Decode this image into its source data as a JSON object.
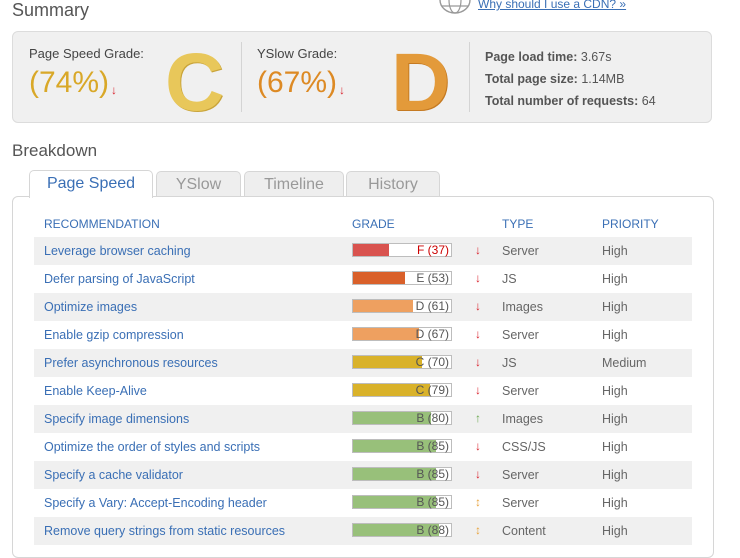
{
  "summary": {
    "title": "Summary",
    "cdn_link": "Why should I use a CDN? »",
    "pagespeed": {
      "label": "Page Speed Grade:",
      "percent": "(74%)",
      "letter": "C",
      "trend": "↓"
    },
    "yslow": {
      "label": "YSlow Grade:",
      "percent": "(67%)",
      "letter": "D",
      "trend": "↓"
    },
    "stats": [
      {
        "label": "Page load time:",
        "value": "3.67s"
      },
      {
        "label": "Total page size:",
        "value": "1.14MB"
      },
      {
        "label": "Total number of requests:",
        "value": "64"
      }
    ]
  },
  "breakdown": {
    "title": "Breakdown",
    "tabs": [
      "Page Speed",
      "YSlow",
      "Timeline",
      "History"
    ],
    "active_tab": "Page Speed",
    "headers": {
      "recommendation": "RECOMMENDATION",
      "grade": "GRADE",
      "type": "TYPE",
      "priority": "PRIORITY"
    },
    "rows": [
      {
        "rec": "Leverage browser caching",
        "grade": "F (37)",
        "score": 37,
        "color": "#d9534f",
        "trend": "↓",
        "trend_color": "#d9232e",
        "type": "Server",
        "priority": "High"
      },
      {
        "rec": "Defer parsing of JavaScript",
        "grade": "E (53)",
        "score": 53,
        "color": "#d9602a",
        "trend": "↓",
        "trend_color": "#d9232e",
        "type": "JS",
        "priority": "High"
      },
      {
        "rec": "Optimize images",
        "grade": "D (61)",
        "score": 61,
        "color": "#eea060",
        "trend": "↓",
        "trend_color": "#d9232e",
        "type": "Images",
        "priority": "High"
      },
      {
        "rec": "Enable gzip compression",
        "grade": "D (67)",
        "score": 67,
        "color": "#eea060",
        "trend": "↓",
        "trend_color": "#d9232e",
        "type": "Server",
        "priority": "High"
      },
      {
        "rec": "Prefer asynchronous resources",
        "grade": "C (70)",
        "score": 70,
        "color": "#d9b22a",
        "trend": "↓",
        "trend_color": "#d9232e",
        "type": "JS",
        "priority": "Medium"
      },
      {
        "rec": "Enable Keep-Alive",
        "grade": "C (79)",
        "score": 79,
        "color": "#d9b22a",
        "trend": "↓",
        "trend_color": "#d9232e",
        "type": "Server",
        "priority": "High"
      },
      {
        "rec": "Specify image dimensions",
        "grade": "B (80)",
        "score": 80,
        "color": "#98c07a",
        "trend": "↑",
        "trend_color": "#6aa84f",
        "type": "Images",
        "priority": "High"
      },
      {
        "rec": "Optimize the order of styles and scripts",
        "grade": "B (85)",
        "score": 85,
        "color": "#98c07a",
        "trend": "↓",
        "trend_color": "#d9232e",
        "type": "CSS/JS",
        "priority": "High"
      },
      {
        "rec": "Specify a cache validator",
        "grade": "B (85)",
        "score": 85,
        "color": "#98c07a",
        "trend": "↓",
        "trend_color": "#d9232e",
        "type": "Server",
        "priority": "High"
      },
      {
        "rec": "Specify a Vary: Accept-Encoding header",
        "grade": "B (85)",
        "score": 85,
        "color": "#98c07a",
        "trend": "↕",
        "trend_color": "#e8a23a",
        "type": "Server",
        "priority": "High"
      },
      {
        "rec": "Remove query strings from static resources",
        "grade": "B (88)",
        "score": 88,
        "color": "#98c07a",
        "trend": "↕",
        "trend_color": "#e8a23a",
        "type": "Content",
        "priority": "High"
      }
    ]
  }
}
